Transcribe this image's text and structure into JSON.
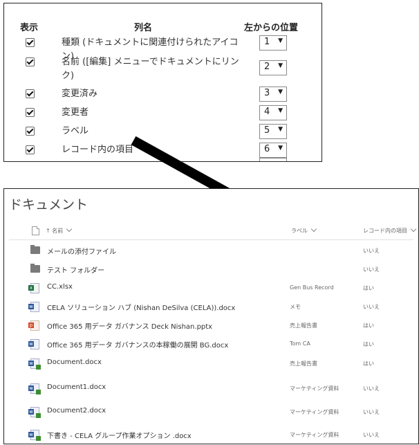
{
  "settings": {
    "header_show": "表示",
    "header_column": "列名",
    "header_position": "左からの位置",
    "rows": [
      {
        "name": "種類 (ドキュメントに関連付けられたアイコン)",
        "position": "1"
      },
      {
        "name": "名前 ([編集] メニューでドキュメントにリンク)",
        "position": "2"
      },
      {
        "name": "変更済み",
        "position": "3"
      },
      {
        "name": "変更者",
        "position": "4"
      },
      {
        "name": "ラベル",
        "position": "5"
      },
      {
        "name": "レコード内の項目",
        "position": "6"
      }
    ],
    "caret": "▼"
  },
  "library": {
    "title": "ドキュメント",
    "col_name": "↑ 名前",
    "col_label": "ラベル",
    "col_record": "レコード内の項目",
    "rows": [
      {
        "icon": "folder-icon",
        "name": "メールの添付ファイル",
        "label": "",
        "record": "いいえ"
      },
      {
        "icon": "folder-icon",
        "name": "テスト フォルダー",
        "label": "",
        "record": "いいえ"
      },
      {
        "icon": "excel-file-icon",
        "name": "CC.xlsx",
        "label": "Gen Bus Record",
        "record": "はい"
      },
      {
        "icon": "word-file-icon",
        "name": "CELA ソリューション ハブ (Nishan DeSilva (CELA)).docx",
        "label": "メモ",
        "record": "いいえ"
      },
      {
        "icon": "powerpoint-file-icon",
        "name": "Office 365 用データ ガバナンス Deck Nishan.pptx",
        "label": "売上報告書",
        "record": "はい"
      },
      {
        "icon": "word-file-icon",
        "name": "Office 365 用データ ガバナンスの本稼働の展開 BG.docx",
        "label": "Tom CA",
        "record": "はい"
      },
      {
        "icon": "word-record-file-icon",
        "name": "Document.docx",
        "label": "売上報告書",
        "record": "はい"
      },
      {
        "icon": "word-record-file-icon",
        "name": "Document1.docx",
        "label": "マーケティング資料",
        "record": "いいえ"
      },
      {
        "icon": "word-record-file-icon",
        "name": "Document2.docx",
        "label": "マーケティング資料",
        "record": "いいえ"
      },
      {
        "icon": "word-record-file-icon",
        "name": "下書き - CELA グループ作業オプション .docx",
        "label": "マーケティング資料",
        "record": "いいえ"
      }
    ]
  }
}
